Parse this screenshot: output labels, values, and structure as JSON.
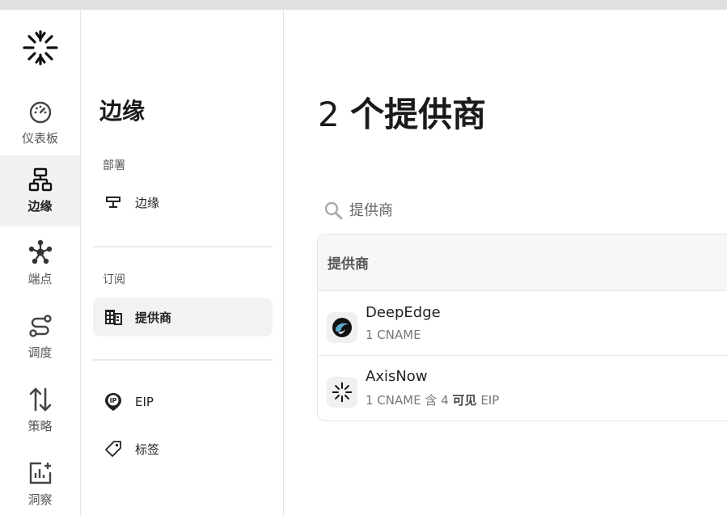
{
  "rail": {
    "logo": "axisnow-logo",
    "items": [
      {
        "label": "仪表板",
        "icon": "gauge-icon"
      },
      {
        "label": "边缘",
        "icon": "network-icon",
        "active": true
      },
      {
        "label": "端点",
        "icon": "hub-icon"
      },
      {
        "label": "调度",
        "icon": "route-icon"
      },
      {
        "label": "策略",
        "icon": "arrows-updown-icon"
      },
      {
        "label": "洞察",
        "icon": "chart-plus-icon"
      }
    ]
  },
  "subnav": {
    "title": "边缘",
    "sections": [
      {
        "label": "部署",
        "links": [
          {
            "label": "边缘",
            "icon": "edge-icon"
          }
        ]
      },
      {
        "label": "订阅",
        "links": [
          {
            "label": "提供商",
            "icon": "building-icon",
            "active": true
          }
        ]
      }
    ],
    "extra_links": [
      {
        "label": "EIP",
        "icon": "ip-pin-icon"
      },
      {
        "label": "标签",
        "icon": "tag-icon"
      }
    ]
  },
  "main": {
    "title_count": "2",
    "title_word": "个提供商",
    "search": {
      "placeholder": "提供商"
    },
    "table": {
      "header": "提供商",
      "rows": [
        {
          "name": "DeepEdge",
          "sub_prefix": "1 CNAME",
          "icon": "deepedge-logo"
        },
        {
          "name": "AxisNow",
          "sub_prefix": "1 CNAME 含 4 ",
          "sub_bold": "可见",
          "sub_suffix": " EIP",
          "icon": "axisnow-logo"
        }
      ]
    }
  },
  "colors": {
    "accent": "#1a1a1a",
    "active_bg": "#f1f1f1",
    "topbar": "#e0e0e0"
  }
}
